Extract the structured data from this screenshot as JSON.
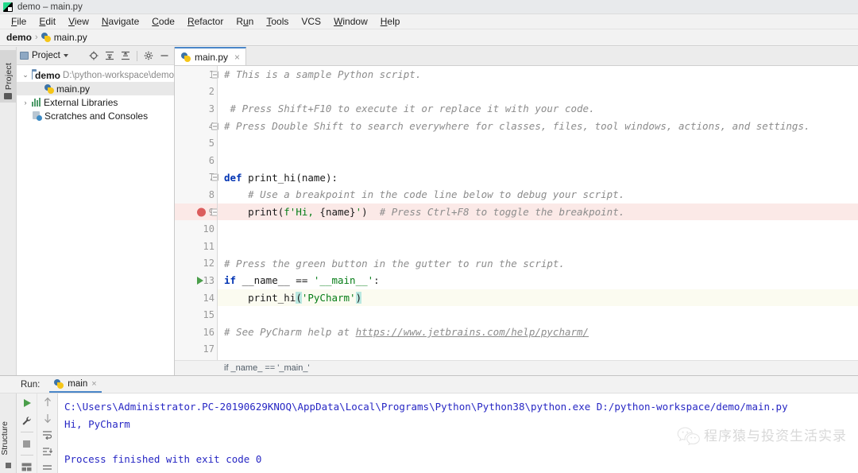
{
  "window": {
    "title": "demo – main.py",
    "app_icon": "pycharm-icon"
  },
  "menubar": [
    {
      "label": "File"
    },
    {
      "label": "Edit"
    },
    {
      "label": "View"
    },
    {
      "label": "Navigate"
    },
    {
      "label": "Code"
    },
    {
      "label": "Refactor"
    },
    {
      "label": "Run"
    },
    {
      "label": "Tools"
    },
    {
      "label": "VCS"
    },
    {
      "label": "Window"
    },
    {
      "label": "Help"
    }
  ],
  "navbar": {
    "root": "demo",
    "separator": "›",
    "file": "main.py"
  },
  "left_strip": {
    "project_tab": "Project"
  },
  "project_panel": {
    "title": "Project",
    "toolbar_icons": [
      "locate-icon",
      "expand-all-icon",
      "collapse-all-icon",
      "settings-gear-icon",
      "minimize-icon"
    ],
    "tree": [
      {
        "label": "demo",
        "path": "D:\\python-workspace\\demo",
        "arrow": "v",
        "icon": "folder-icon",
        "bold": true,
        "indent": 0,
        "selected": false
      },
      {
        "label": "main.py",
        "path": "",
        "arrow": "",
        "icon": "python-file-icon",
        "bold": false,
        "indent": 1,
        "selected": true
      },
      {
        "label": "External Libraries",
        "path": "",
        "arrow": ">",
        "icon": "library-icon",
        "bold": false,
        "indent": 0,
        "selected": false
      },
      {
        "label": "Scratches and Consoles",
        "path": "",
        "arrow": "",
        "icon": "scratches-icon",
        "bold": false,
        "indent": 0,
        "selected": false
      }
    ]
  },
  "editor": {
    "tab": {
      "label": "main.py",
      "icon": "python-file-icon",
      "close": "×"
    },
    "breadcrumb": "if _name_ == '_main_'",
    "lines": [
      {
        "n": "1",
        "fold": true,
        "marker": "",
        "hl": "",
        "tokens": [
          {
            "t": "# This is a sample Python script.",
            "c": "cmt"
          }
        ]
      },
      {
        "n": "2",
        "fold": false,
        "marker": "",
        "hl": "",
        "tokens": []
      },
      {
        "n": "3",
        "fold": false,
        "marker": "",
        "hl": "",
        "tokens": [
          {
            "t": " # Press Shift+F10 to execute it or replace it with your code.",
            "c": "cmt"
          }
        ]
      },
      {
        "n": "4",
        "fold": true,
        "marker": "",
        "hl": "",
        "tokens": [
          {
            "t": "# Press Double Shift to search everywhere for classes, files, tool windows, actions, and settings.",
            "c": "cmt"
          }
        ]
      },
      {
        "n": "5",
        "fold": false,
        "marker": "",
        "hl": "",
        "tokens": []
      },
      {
        "n": "6",
        "fold": false,
        "marker": "",
        "hl": "",
        "tokens": []
      },
      {
        "n": "7",
        "fold": true,
        "marker": "",
        "hl": "",
        "tokens": [
          {
            "t": "def ",
            "c": "kw"
          },
          {
            "t": "print_hi(name):",
            "c": "plain"
          }
        ]
      },
      {
        "n": "8",
        "fold": false,
        "marker": "",
        "hl": "",
        "tokens": [
          {
            "t": "    # Use a breakpoint in the code line below to debug your script.",
            "c": "cmt"
          }
        ]
      },
      {
        "n": "9",
        "fold": true,
        "marker": "breakpoint",
        "hl": "red",
        "tokens": [
          {
            "t": "    print(",
            "c": "plain"
          },
          {
            "t": "f'Hi, ",
            "c": "str"
          },
          {
            "t": "{name}",
            "c": "plain"
          },
          {
            "t": "'",
            "c": "str"
          },
          {
            "t": ")",
            "c": "plain"
          },
          {
            "t": "  # Press Ctrl+F8 to toggle the breakpoint.",
            "c": "cmt"
          }
        ]
      },
      {
        "n": "10",
        "fold": false,
        "marker": "",
        "hl": "",
        "tokens": []
      },
      {
        "n": "11",
        "fold": false,
        "marker": "",
        "hl": "",
        "tokens": []
      },
      {
        "n": "12",
        "fold": false,
        "marker": "",
        "hl": "",
        "tokens": [
          {
            "t": "# Press the green button in the gutter to run the script.",
            "c": "cmt"
          }
        ]
      },
      {
        "n": "13",
        "fold": false,
        "marker": "run",
        "hl": "",
        "tokens": [
          {
            "t": "if ",
            "c": "kw"
          },
          {
            "t": "__name__ == ",
            "c": "plain"
          },
          {
            "t": "'__main__'",
            "c": "str"
          },
          {
            "t": ":",
            "c": "plain"
          }
        ]
      },
      {
        "n": "14",
        "fold": false,
        "marker": "",
        "hl": "yellow",
        "tokens": [
          {
            "t": "    print_hi",
            "c": "plain"
          },
          {
            "t": "(",
            "c": "brace"
          },
          {
            "t": "'PyCharm'",
            "c": "str"
          },
          {
            "t": ")",
            "c": "brace"
          }
        ]
      },
      {
        "n": "15",
        "fold": false,
        "marker": "",
        "hl": "",
        "tokens": []
      },
      {
        "n": "16",
        "fold": false,
        "marker": "",
        "hl": "",
        "tokens": [
          {
            "t": "# See PyCharm help at ",
            "c": "cmt"
          },
          {
            "t": "https://www.jetbrains.com/help/pycharm/",
            "c": "link"
          }
        ]
      },
      {
        "n": "17",
        "fold": false,
        "marker": "",
        "hl": "",
        "tokens": []
      }
    ]
  },
  "run_window": {
    "label": "Run:",
    "tab": {
      "label": "main",
      "icon": "python-file-icon",
      "close": "×"
    },
    "strip_label": "Structure",
    "left_tools": [
      "run-icon",
      "wrench-icon",
      "stop-icon",
      "layout-icon"
    ],
    "right_tools": [
      "arrow-up-icon",
      "arrow-down-icon",
      "soft-wrap-icon",
      "scroll-to-end-icon",
      "print-icon"
    ],
    "console": [
      "C:\\Users\\Administrator.PC-20190629KNOQ\\AppData\\Local\\Programs\\Python\\Python38\\python.exe D:/python-workspace/demo/main.py",
      "Hi, PyCharm",
      "",
      "Process finished with exit code 0"
    ]
  },
  "watermark": {
    "icon": "wechat-icon",
    "text": "程序猿与投资生活实录"
  },
  "colors": {
    "accent": "#4a86c8",
    "breakpoint": "#db5c5c",
    "run_green": "#4a9e4a",
    "keyword": "#0033b3",
    "string": "#067d17",
    "comment": "#8c8c8c",
    "console_text": "#2727c4",
    "line_hl_red": "#fbe9e7",
    "line_hl_yellow": "#fbfbf0"
  }
}
